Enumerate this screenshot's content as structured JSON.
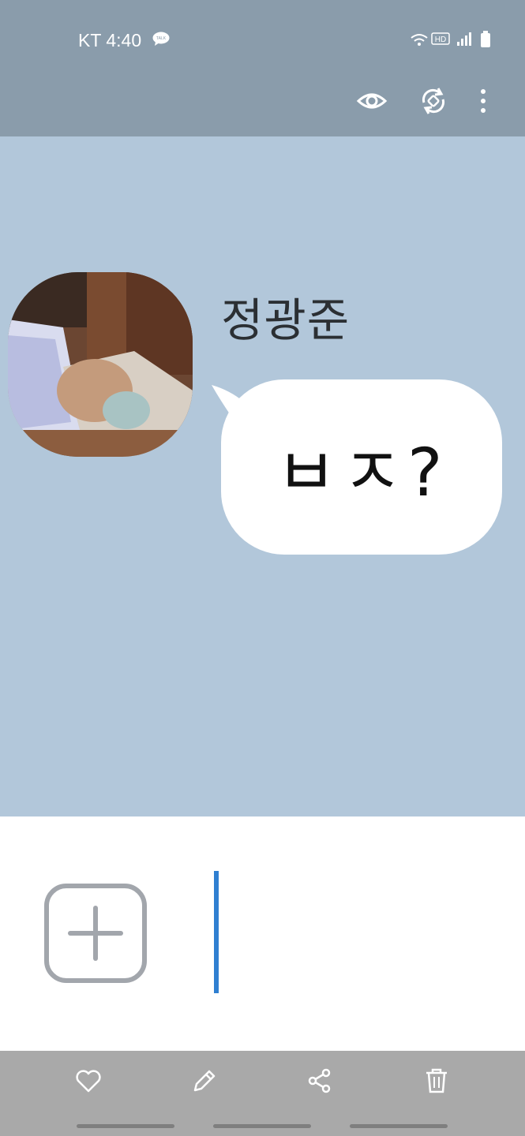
{
  "status_bar": {
    "carrier_time": "KT 4:40",
    "talk_badge": "TALK",
    "hd_badge": "HD",
    "icons": [
      "talk-notification-icon",
      "wifi-icon",
      "hd-voice-icon",
      "signal-icon",
      "battery-icon"
    ]
  },
  "toolbar": {
    "icons": [
      "eye-icon",
      "rotate-icon",
      "more-vertical-icon"
    ]
  },
  "chat": {
    "sender_name": "정광준",
    "message": "ㅂㅈ?",
    "avatar": "profile-photo"
  },
  "input": {
    "add_icon": "plus-icon"
  },
  "bottom_bar": {
    "icons": [
      "heart-icon",
      "edit-icon",
      "share-icon",
      "trash-icon"
    ]
  },
  "colors": {
    "status_bar_bg": "#8a9cab",
    "chat_bg": "#b2c7da",
    "bubble_bg": "#ffffff",
    "cursor": "#2f7fd1",
    "bottom_bar_bg": "#a9a9a9"
  }
}
